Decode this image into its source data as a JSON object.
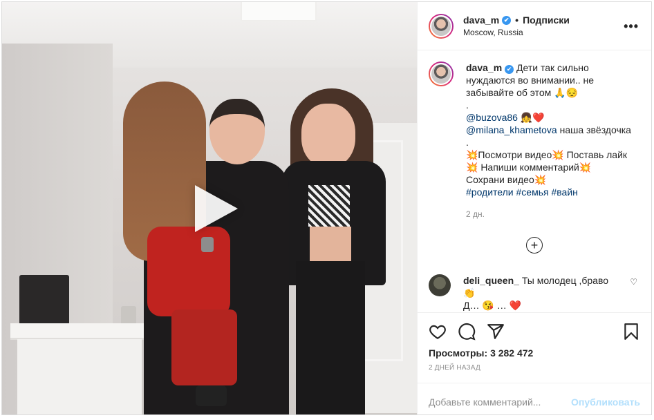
{
  "post": {
    "author": "dava_m",
    "follow_label": "Подписки",
    "location": "Moscow, Russia",
    "more_label": "•••",
    "media": {
      "play_icon": "play-icon"
    },
    "caption": {
      "author": "dava_m",
      "text_line1": "Дети так сильно нуждаются во внимании.. не забывайте об этом 🙏😔",
      "dot1": ".",
      "mention1": "@buzova86",
      "mention1_suffix": " 👧❤️",
      "mention2": "@milana_khametova",
      "mention2_suffix": " наша звёздочка",
      "dot2": ".",
      "line_cta1": "💥Посмотри видео💥 Поставь лайк 💥 Напиши комментарий💥",
      "line_cta2": "Сохрани видео💥",
      "hashtag1": "#родители",
      "hashtag2": "#семья",
      "hashtag3": "#вайн",
      "time": "2 дн."
    },
    "load_more_label": "+",
    "comments": [
      {
        "user": "deli_queen_",
        "text": "Ты молодец ,браво 👏",
        "text2": "Д… 😘 … ❤️"
      }
    ],
    "views_label": "Просмотры:",
    "views_value": "3 282 472",
    "date": "2 дней назад",
    "comment_placeholder": "Добавьте комментарий...",
    "publish_label": "Опубликовать"
  },
  "colors": {
    "accent": "#3897f0",
    "link": "#00376b",
    "muted": "#8e8e8e",
    "publish_disabled": "#b2dffc"
  }
}
